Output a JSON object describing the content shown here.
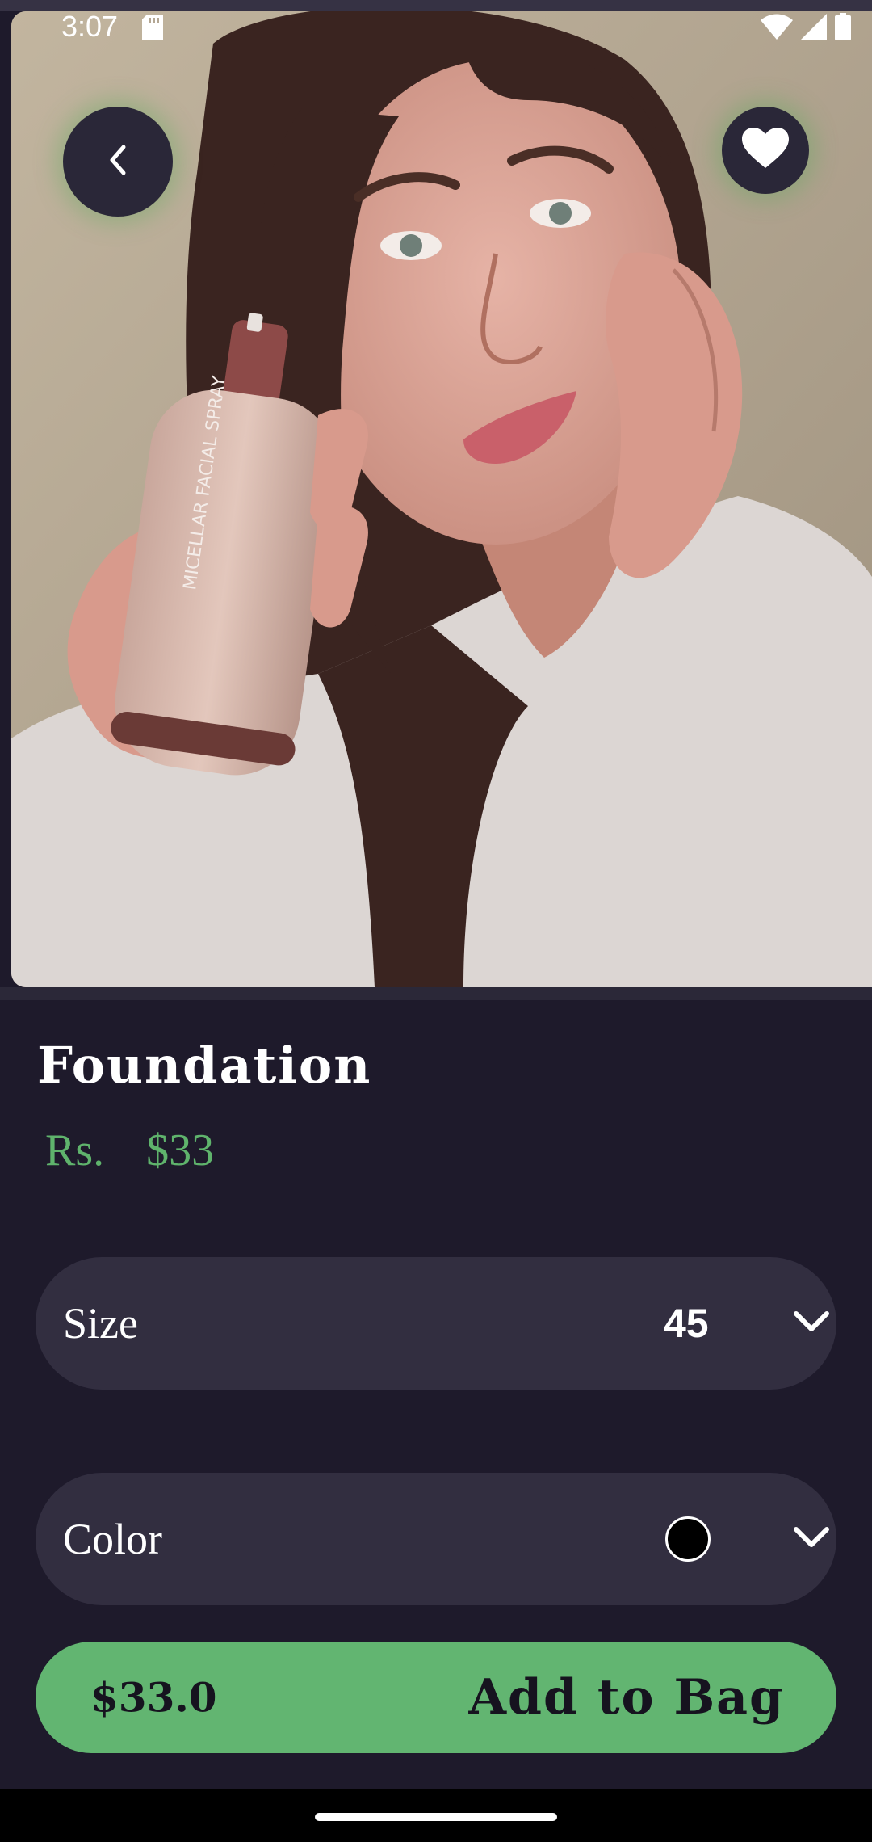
{
  "status_bar": {
    "time": "3:07",
    "icons": [
      "sd-card-icon",
      "wifi-icon",
      "signal-icon",
      "battery-icon"
    ]
  },
  "hero": {
    "image_icon": "product-photo",
    "back_icon": "chevron-left-icon",
    "favorite_icon": "heart-icon"
  },
  "product": {
    "name": "Foundation",
    "currency_label": "Rs.",
    "price": "$33"
  },
  "size_selector": {
    "label": "Size",
    "value": "45"
  },
  "color_selector": {
    "label": "Color",
    "selected_color": "#000000"
  },
  "add_to_bag": {
    "price": "$33.0",
    "label": "Add to Bag"
  },
  "colors": {
    "background": "#1e1a2b",
    "pill": "#322e40",
    "accent_green": "#62b571",
    "price_green": "#5fb36c"
  }
}
